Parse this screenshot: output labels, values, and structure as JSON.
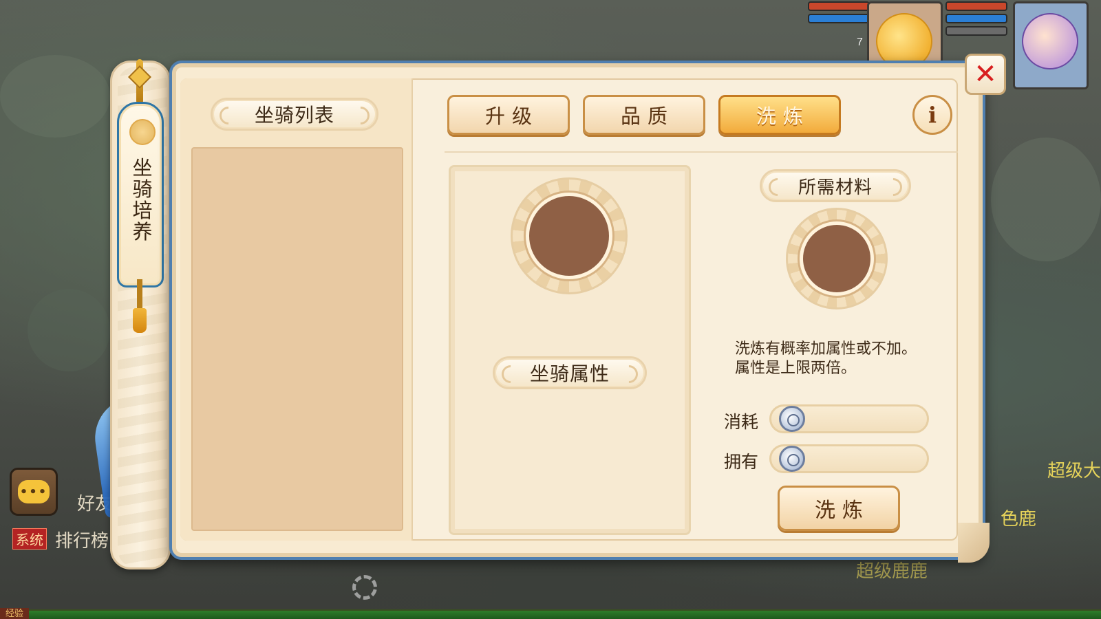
{
  "hud": {
    "level_left": "7",
    "colors": {
      "hp": "#c9472b",
      "mp": "#2b7fd6",
      "exp": "#2e7d2a"
    }
  },
  "side_tag": {
    "title": "坐骑培养"
  },
  "left_panel": {
    "title": "坐骑列表"
  },
  "tabs": [
    {
      "label": "升级",
      "active": false
    },
    {
      "label": "品质",
      "active": false
    },
    {
      "label": "洗炼",
      "active": true
    }
  ],
  "info_button": {
    "label": "i"
  },
  "close_button": {
    "label": "✕"
  },
  "attr_card": {
    "title": "坐骑属性"
  },
  "materials": {
    "title": "所需材料",
    "description": [
      "洗炼有概率加属性或不加。",
      "属性是上限两倍。"
    ],
    "consume_label": "消耗",
    "own_label": "拥有",
    "consume_value": "",
    "own_value": ""
  },
  "wash_button": {
    "label": "洗炼"
  },
  "background": {
    "chat_icon_text": "•••",
    "friend_text": "好友",
    "system_tag": "系统",
    "ranking_text": "排行榜",
    "npc_name_1": "超级大",
    "npc_name_2": "色鹿",
    "npc_name_3": "超级鹿鹿",
    "exp_label": "经验"
  }
}
